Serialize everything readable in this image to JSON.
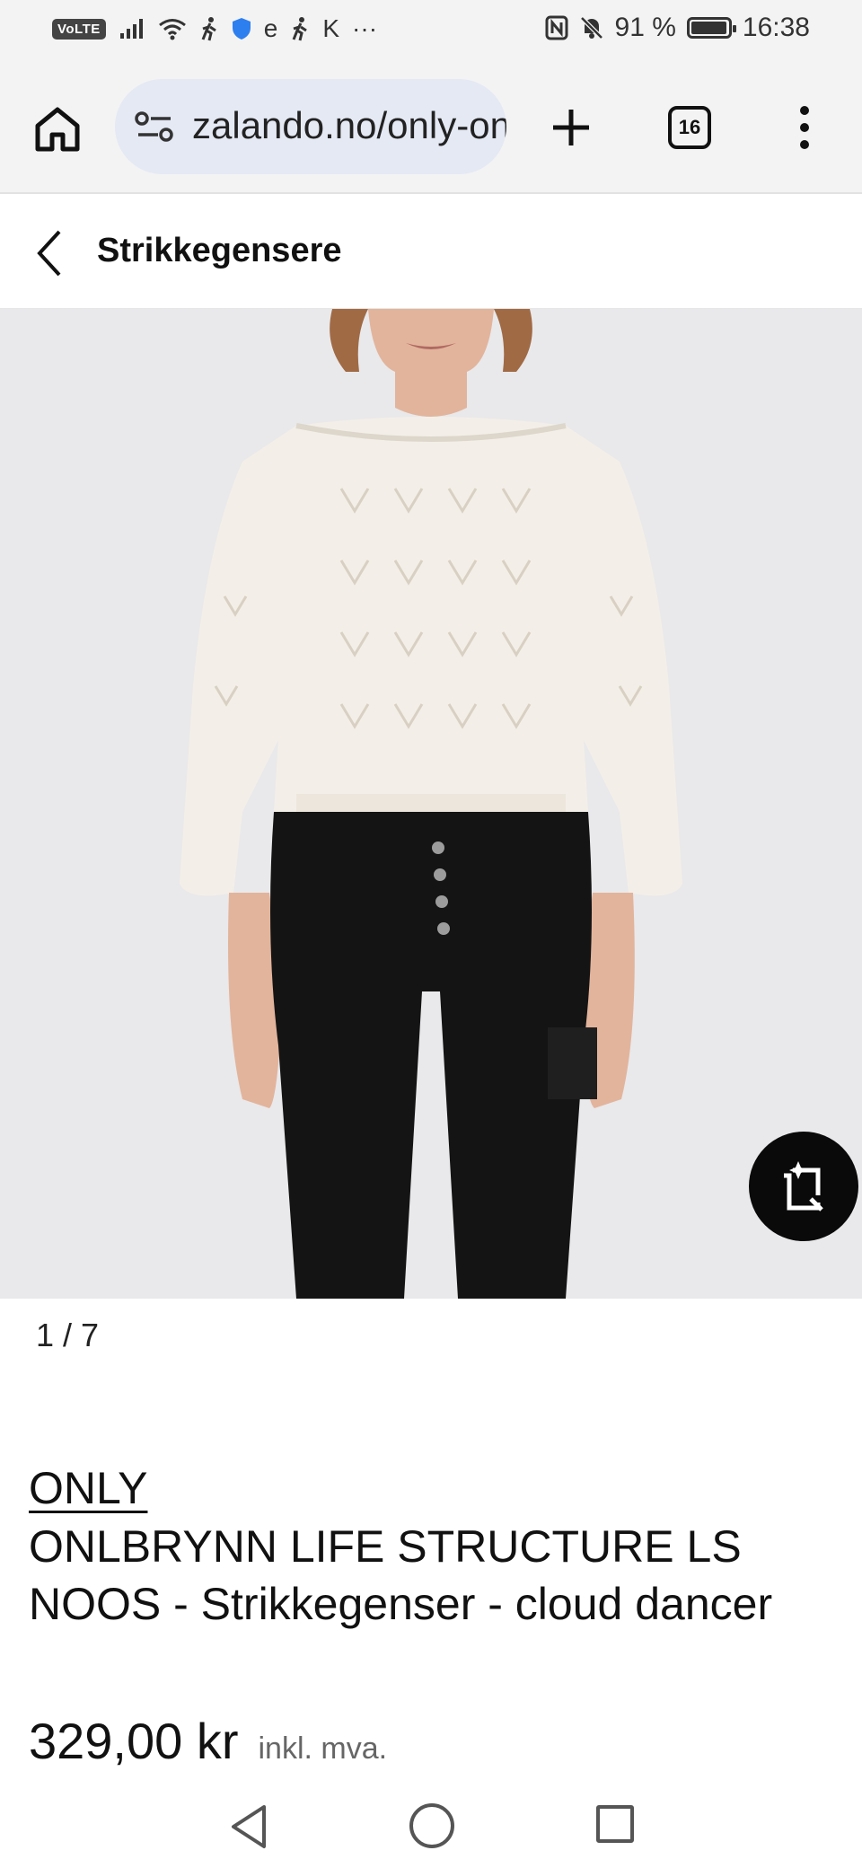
{
  "status_bar": {
    "network_badge": "VoLTE",
    "extra_icons_text": "e",
    "carrier_letter": "K",
    "more": "···",
    "battery_percent": "91 %",
    "battery_level": 0.91,
    "time": "16:38"
  },
  "browser": {
    "url": "zalando.no/only-onlbrynn",
    "tab_count": "16"
  },
  "header": {
    "title": "Strikkegensere"
  },
  "gallery": {
    "counter": "1 / 7",
    "colors": {
      "background": "#e9e9eb",
      "sweater": "#f3efe8",
      "jeans": "#141414",
      "skin": "#e2b49c"
    }
  },
  "product": {
    "brand": "ONLY",
    "name": "ONLBRYNN LIFE STRUCTURE LS NOOS - Strikkegenser - cloud dancer",
    "price": "329,00 kr",
    "tax_note": "inkl. mva."
  },
  "icons": {
    "home": "home-icon",
    "site_settings": "site-settings-icon",
    "new_tab": "plus-icon",
    "tabs": "tab-switcher-icon",
    "menu": "more-vert-icon",
    "back": "chevron-left-icon",
    "visual_search": "visual-search-icon"
  }
}
